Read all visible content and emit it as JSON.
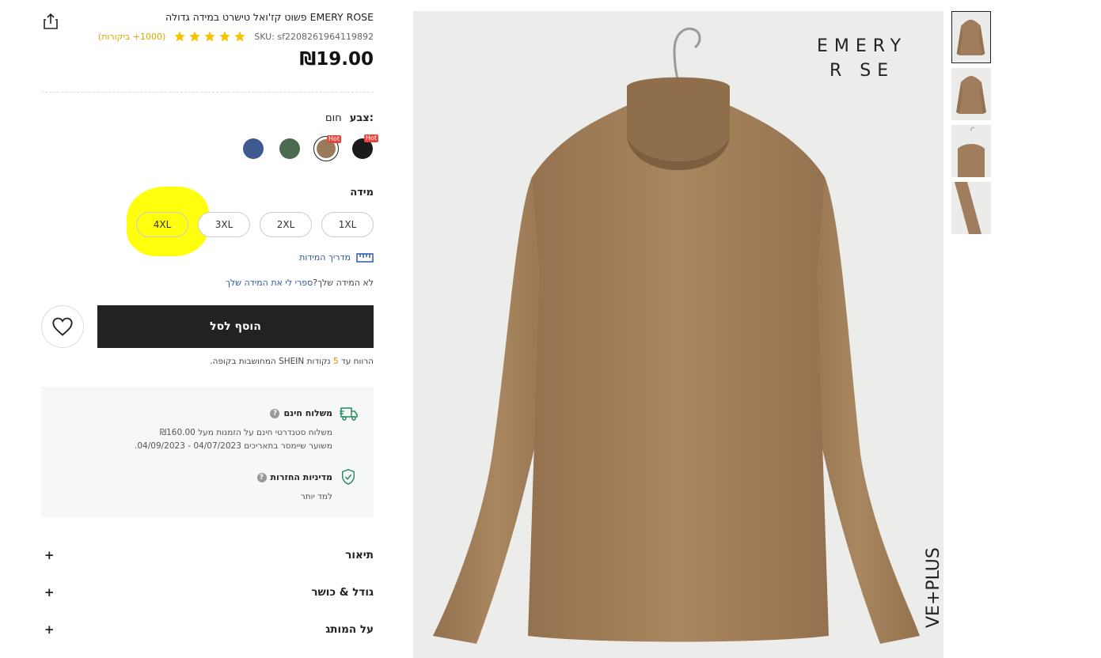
{
  "product": {
    "title": "EMERY ROSE פשוט קז'ואל טישרט במידה גדולה",
    "sku": "SKU: sf2208261964119892",
    "rating": 5,
    "reviews": "(1000+ ביקורות)",
    "price": "₪19.00"
  },
  "color": {
    "label": "צבע:",
    "selected": "חום",
    "swatches": [
      {
        "name": "black",
        "hex": "#1b1b1b",
        "hot": "Hot"
      },
      {
        "name": "brown",
        "hex": "#9a7a5c",
        "hot": "Hot",
        "selected": true
      },
      {
        "name": "green",
        "hex": "#4a6b4e",
        "hot": ""
      },
      {
        "name": "blue",
        "hex": "#3f5a8f",
        "hot": ""
      }
    ]
  },
  "size": {
    "label": "מידה",
    "options": [
      "1XL",
      "2XL",
      "3XL",
      "4XL"
    ],
    "guide": "מדריך המידות",
    "fit_prefix": "לא המידה שלך?",
    "fit_link": "ספרי לי את המידה שלך"
  },
  "actions": {
    "add_to_cart": "הוסף לסל"
  },
  "points": {
    "prefix": "הרווח עד",
    "count": "5",
    "suffix": "נקודות SHEIN המחושבות בקופה."
  },
  "shipping": {
    "title": "משלוח חינם",
    "line1": "משלוח סטנדרטי חינם על הזמנות מעל ₪160.00",
    "line2": "משוער שיימסר בתאריכים 04/07/2023 - 04/09/2023."
  },
  "returns": {
    "title": "מדיניות החזרות",
    "more": "למד יותר"
  },
  "accordions": [
    {
      "label": "תיאור",
      "icon": "+"
    },
    {
      "label": "גודל & כושר",
      "icon": "+"
    },
    {
      "label": "על המותג",
      "icon": "+"
    }
  ],
  "image": {
    "brand_line1": "EMERY",
    "brand_line2": "R SE",
    "side_text": "VE+PLUS"
  },
  "colors": {
    "accent_star": "#f5c400",
    "link": "#2a5aa8",
    "highlight": "#ffff00",
    "shirt": "#a07d5c"
  }
}
